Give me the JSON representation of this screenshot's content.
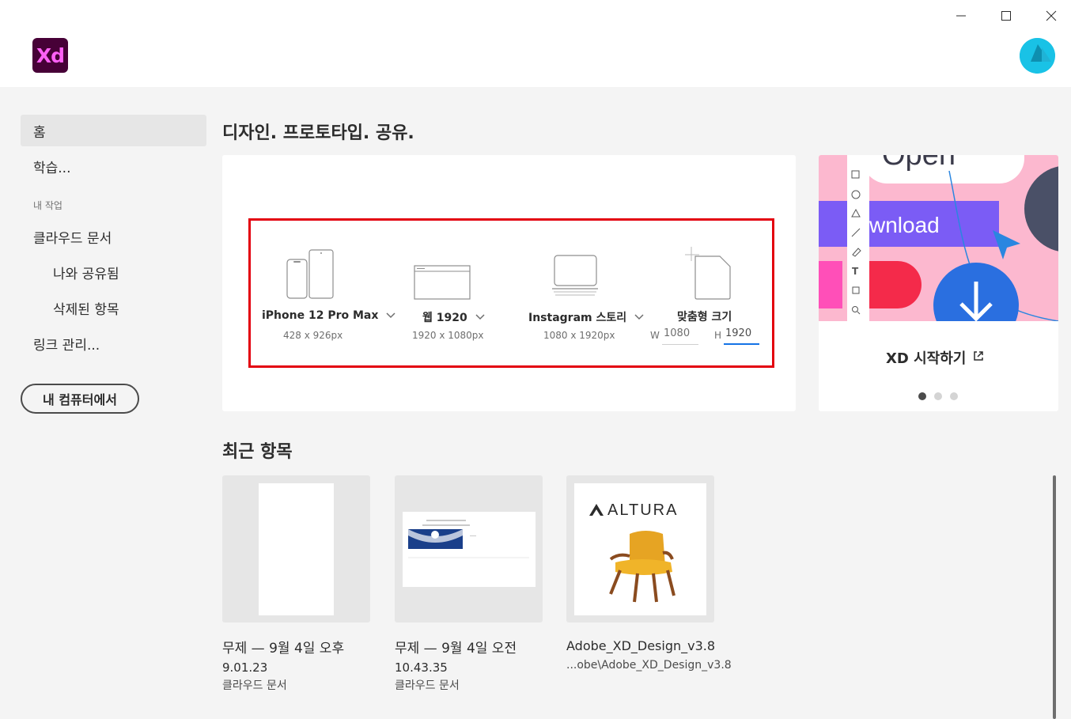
{
  "app": {
    "logo_text": "Xd",
    "logo_bg": "#470137",
    "logo_fg": "#ff61f6",
    "window_controls": [
      "minimize-icon",
      "maximize-icon",
      "close-icon"
    ]
  },
  "sidebar": {
    "items": [
      {
        "label": "홈",
        "active": true
      },
      {
        "label": "학습..."
      }
    ],
    "section_label": "내 작업",
    "work_items": [
      {
        "label": "클라우드 문서"
      },
      {
        "label": "나와 공유됨",
        "indent": true
      },
      {
        "label": "삭제된 항목",
        "indent": true
      },
      {
        "label": "링크 관리..."
      }
    ],
    "computer_button": "내 컴퓨터에서"
  },
  "main": {
    "headline": "디자인. 프로토타입. 공유.",
    "presets": [
      {
        "name": "iPhone 12 Pro Max",
        "size": "428 x 926px",
        "icon": "phone-tablet-icon",
        "dropdown": true
      },
      {
        "name": "웹 1920",
        "size": "1920 x 1080px",
        "icon": "browser-icon",
        "dropdown": true
      },
      {
        "name": "Instagram 스토리",
        "size": "1080 x 1920px",
        "icon": "laptop-icon",
        "dropdown": true
      },
      {
        "name": "맞춤형 크기",
        "icon": "custom-page-icon",
        "width_label": "W",
        "width_value": "1080",
        "height_label": "H",
        "height_value": "1920"
      }
    ],
    "highlight_color": "#e3000f"
  },
  "promo": {
    "link_text": "XD 시작하기",
    "illustration_text": "wnload",
    "illustration_top_text": "Open",
    "dots": 3,
    "active_dot": 0
  },
  "recent": {
    "heading": "최근 항목",
    "items": [
      {
        "title": "무제 — 9월 4일 오후",
        "time": "9.01.23",
        "location": "클라우드 문서"
      },
      {
        "title": "무제 — 9월 4일 오전",
        "time": "10.43.35",
        "location": "클라우드 문서"
      },
      {
        "title": "Adobe_XD_Design_v3.8",
        "location": "...obe\\Adobe_XD_Design_v3.8",
        "thumb_brand": "ALTURA"
      }
    ]
  },
  "colors": {
    "accent": "#1473e6",
    "avatar": "#19c2e6"
  }
}
